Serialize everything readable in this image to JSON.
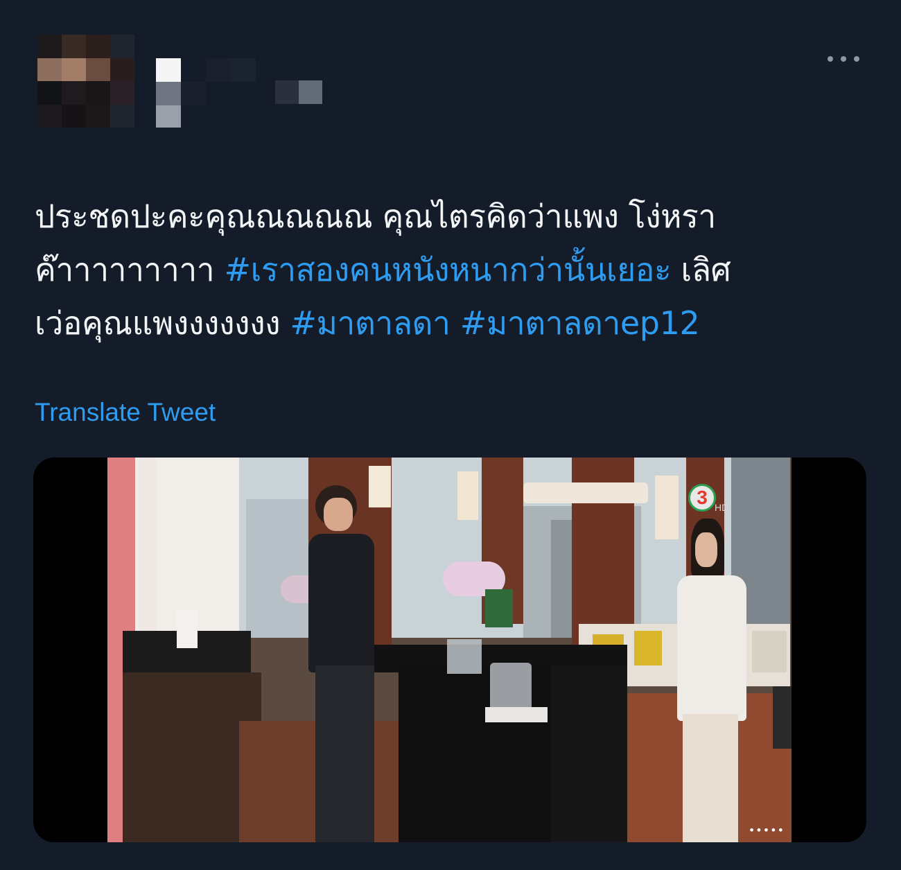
{
  "tweet": {
    "text_lines": [
      [
        {
          "text": "ประชดปะคะคุณณณณณ คุณไตรคิดว่าแพง โง่หรา",
          "hashtag": false
        }
      ],
      [
        {
          "text": "ค๊าาาาาาาาา ",
          "hashtag": false
        },
        {
          "text": "#เราสองคนหนังหนากว่านั้นเยอะ",
          "hashtag": true
        },
        {
          "text": " เลิศ",
          "hashtag": false
        }
      ],
      [
        {
          "text": "เว่อคุณแพงงงงงงง ",
          "hashtag": false
        },
        {
          "text": "#มาตาลดา",
          "hashtag": true
        },
        {
          "text": " ",
          "hashtag": false
        },
        {
          "text": "#มาตาลดาep12",
          "hashtag": true
        }
      ]
    ],
    "translate_label": "Translate Tweet"
  },
  "media": {
    "channel_logo": "3",
    "hd_label": "HD",
    "dots": "•••••"
  },
  "colors": {
    "background": "#151c29",
    "text": "#f2f4f6",
    "link": "#2e9cf0",
    "icon_muted": "#8b98a5"
  },
  "icons": {
    "more": "more-horizontal-icon"
  }
}
